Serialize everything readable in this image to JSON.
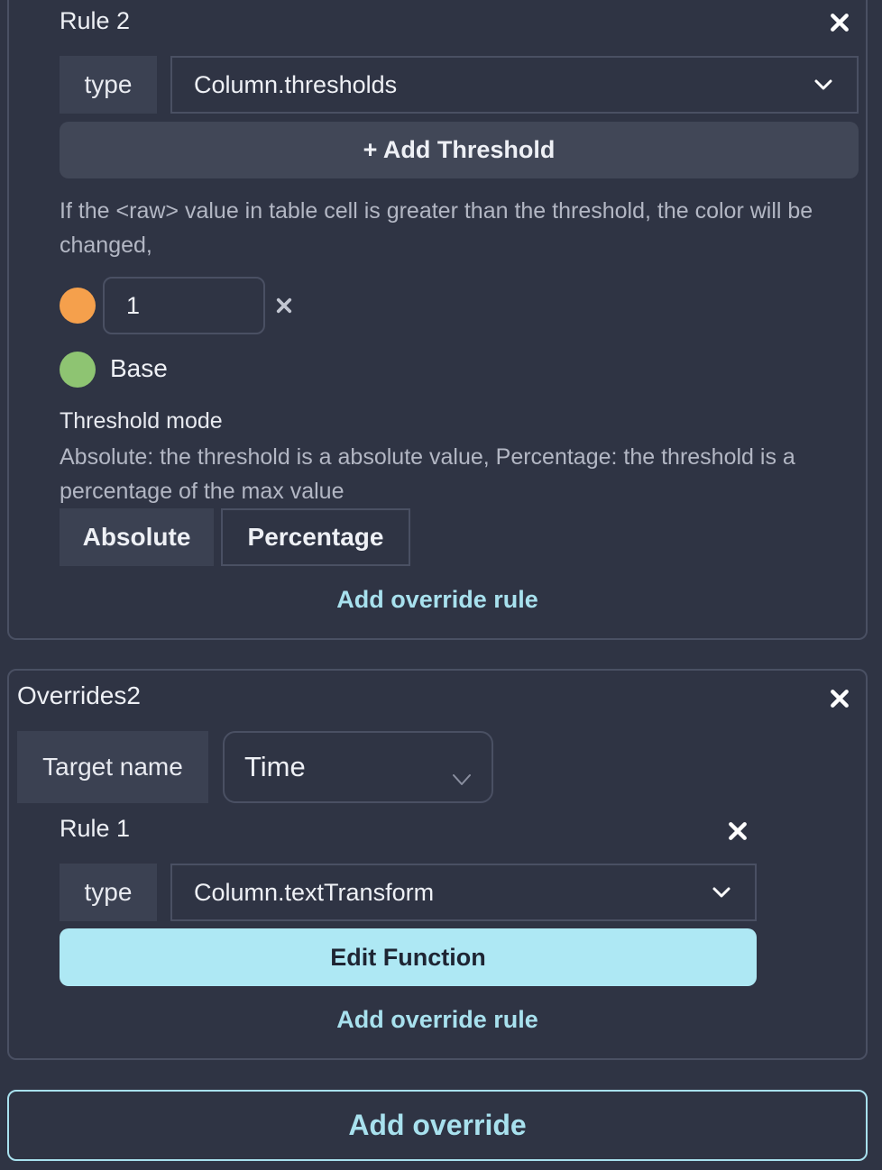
{
  "overrides1": {
    "rule2": {
      "title": "Rule 2",
      "type_label": "type",
      "type_value": "Column.thresholds",
      "add_threshold_label": "+ Add Threshold",
      "help_text": "If the <raw> value in table cell is greater than the threshold, the color will be changed,",
      "thresholds": [
        {
          "color": "#f5a04c",
          "value": "1"
        }
      ],
      "base": {
        "color": "#8ec472",
        "label": "Base"
      },
      "threshold_mode": {
        "title": "Threshold mode",
        "description": "Absolute: the threshold is a absolute value, Percentage: the threshold is a percentage of the max value",
        "options": [
          "Absolute",
          "Percentage"
        ],
        "selected": "Absolute"
      }
    },
    "add_rule_label": "Add override rule"
  },
  "overrides2": {
    "title": "Overrides2",
    "target_label": "Target name",
    "target_value": "Time",
    "rule1": {
      "title": "Rule 1",
      "type_label": "type",
      "type_value": "Column.textTransform",
      "edit_function_label": "Edit Function"
    },
    "add_rule_label": "Add override rule"
  },
  "add_override_label": "Add override",
  "colors": {
    "background": "#2f3444",
    "border": "#4a5063",
    "accent": "#a8e1ee",
    "edit_button": "#aee8f4"
  }
}
